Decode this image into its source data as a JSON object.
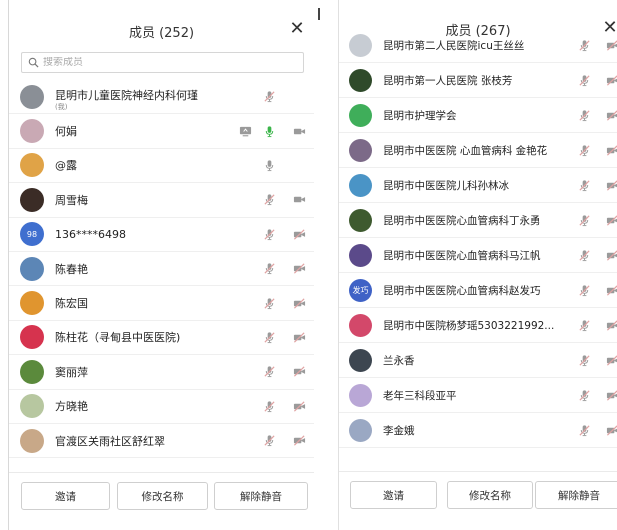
{
  "left": {
    "title": "成员 (252)",
    "search_placeholder": "搜索成员",
    "members": [
      {
        "name": "昆明市儿童医院神经内科何瑾",
        "sub": "(我)",
        "avatar_color": "#8a8f96",
        "avatar_text": "",
        "mic": "muted",
        "cam": "none",
        "screen": false
      },
      {
        "name": "何娟",
        "sub": "",
        "avatar_color": "#c9a9b4",
        "avatar_text": "",
        "mic": "active",
        "cam": "on",
        "screen": true
      },
      {
        "name": "@露",
        "sub": "",
        "avatar_color": "#e0a347",
        "avatar_text": "",
        "mic": "idle",
        "cam": "none",
        "screen": false
      },
      {
        "name": "周雪梅",
        "sub": "",
        "avatar_color": "#3b2c26",
        "avatar_text": "",
        "mic": "muted",
        "cam": "on",
        "screen": false
      },
      {
        "name": "136****6498",
        "sub": "",
        "avatar_color": "#3f6fcf",
        "avatar_text": "98",
        "mic": "muted",
        "cam": "off",
        "screen": false
      },
      {
        "name": "陈春艳",
        "sub": "",
        "avatar_color": "#5c86b6",
        "avatar_text": "",
        "mic": "muted",
        "cam": "off",
        "screen": false
      },
      {
        "name": "陈宏国",
        "sub": "",
        "avatar_color": "#e0952f",
        "avatar_text": "",
        "mic": "muted",
        "cam": "off",
        "screen": false
      },
      {
        "name": "陈柱花（寻甸县中医医院)",
        "sub": "",
        "avatar_color": "#d6334e",
        "avatar_text": "",
        "mic": "muted",
        "cam": "off",
        "screen": false
      },
      {
        "name": "窦丽萍",
        "sub": "",
        "avatar_color": "#5b8a3c",
        "avatar_text": "",
        "mic": "muted",
        "cam": "off",
        "screen": false
      },
      {
        "name": "方晓艳",
        "sub": "",
        "avatar_color": "#b7c7a0",
        "avatar_text": "",
        "mic": "muted",
        "cam": "off",
        "screen": false
      },
      {
        "name": "官渡区关雨社区舒红翠",
        "sub": "",
        "avatar_color": "#c8a888",
        "avatar_text": "",
        "mic": "muted",
        "cam": "off",
        "screen": false
      }
    ],
    "buttons": {
      "invite": "邀请",
      "rename": "修改名称",
      "unmute": "解除静音"
    }
  },
  "right": {
    "title": "成员 (267)",
    "members": [
      {
        "name": "昆明市第二人民医院icu王丝丝",
        "avatar_color": "#c7ccd3",
        "avatar_text": ""
      },
      {
        "name": "昆明市第一人民医院  张枝芳",
        "avatar_color": "#2f4a2a",
        "avatar_text": ""
      },
      {
        "name": "昆明市护理学会",
        "avatar_color": "#3fae5a",
        "avatar_text": ""
      },
      {
        "name": "昆明市中医医院 心血管病科 金艳花",
        "avatar_color": "#7c6a88",
        "avatar_text": ""
      },
      {
        "name": "昆明市中医医院儿科孙林冰",
        "avatar_color": "#4a94c6",
        "avatar_text": ""
      },
      {
        "name": "昆明市中医医院心血管病科丁永勇",
        "avatar_color": "#3e5a2f",
        "avatar_text": ""
      },
      {
        "name": "昆明市中医医院心血管病科马江帆",
        "avatar_color": "#5b4a8a",
        "avatar_text": ""
      },
      {
        "name": "昆明市中医医院心血管病科赵发巧",
        "avatar_color": "#3f62c6",
        "avatar_text": "发巧"
      },
      {
        "name": "昆明市中医院杨梦瑶5303221992...",
        "avatar_color": "#d3486a",
        "avatar_text": ""
      },
      {
        "name": "兰永香",
        "avatar_color": "#3d4650",
        "avatar_text": ""
      },
      {
        "name": "老年三科段亚平",
        "avatar_color": "#b9a7d6",
        "avatar_text": ""
      },
      {
        "name": "李金娥",
        "avatar_color": "#9aa8c3",
        "avatar_text": ""
      }
    ],
    "buttons": {
      "invite": "邀请",
      "rename": "修改名称",
      "unmute": "解除静音"
    }
  },
  "colors": {
    "muted_icon": "#9a9a9a",
    "active_mic": "#3bb54a",
    "muted_slash": "#e0a3a3"
  }
}
